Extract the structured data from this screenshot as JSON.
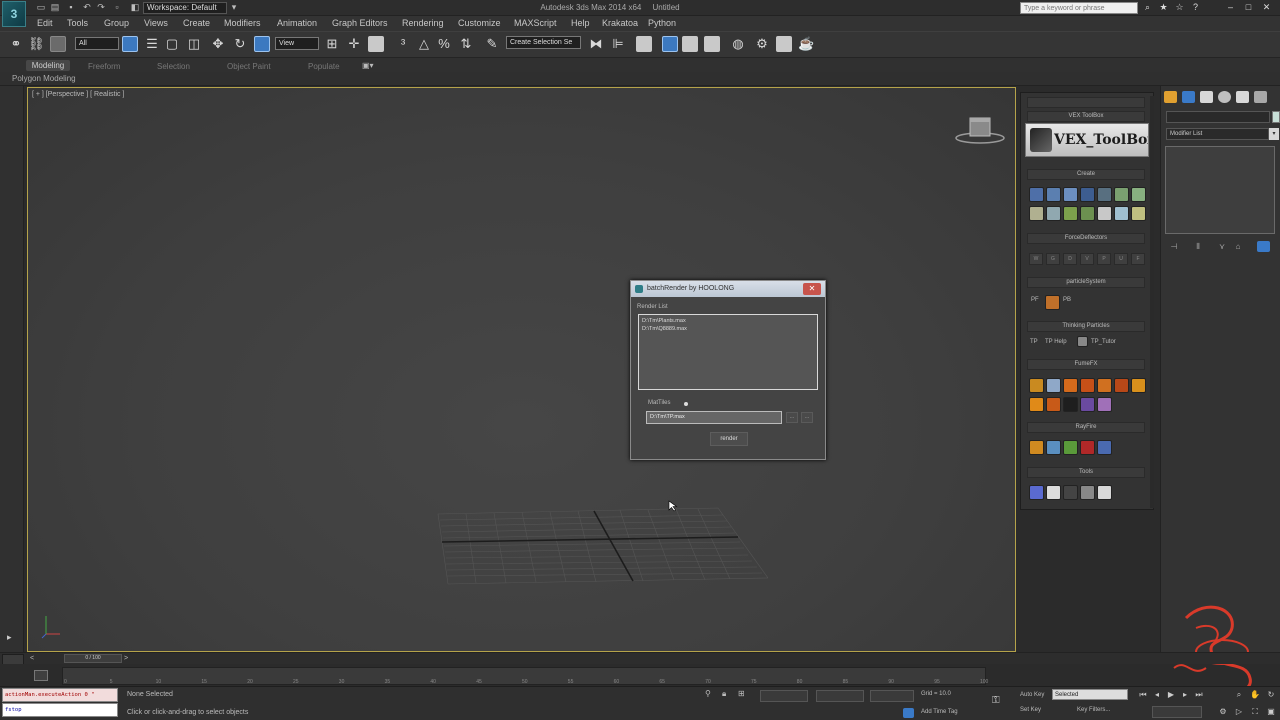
{
  "window": {
    "title": "Autodesk 3ds Max  2014 x64",
    "title_suffix": "Untitled",
    "workspace": "Workspace: Default",
    "search_placeholder": "Type a keyword or phrase"
  },
  "menubar": {
    "items": [
      "Edit",
      "Tools",
      "Group",
      "Views",
      "Create",
      "Modifiers",
      "Animation",
      "Graph Editors",
      "Rendering",
      "Customize",
      "MAXScript",
      "Help",
      "Krakatoa",
      "Python"
    ]
  },
  "toolbar": {
    "selection_filter": "All",
    "reference_coord": "View",
    "named_selection": "Create Selection Se"
  },
  "ribbon": {
    "tabs": [
      "Modeling",
      "Freeform",
      "Selection",
      "Object Paint",
      "Populate"
    ],
    "sub_label": "Polygon Modeling"
  },
  "viewport": {
    "label": "[ + ] [Perspective ] [ Realistic ]"
  },
  "dialog": {
    "title": "batchRender by HOOLONG",
    "render_list_label": "Render List",
    "render_list": [
      "D:\\Tm\\Plants.max",
      "D:\\Tm\\Q8889.max"
    ],
    "mattiles_label": "MatTiles",
    "path_value": "D:\\Tm\\TP.max",
    "browse_label": "...",
    "add_label": "...",
    "render_button": "render"
  },
  "toolbox": {
    "header": "VEX ToolBox",
    "banner_text": "VEX_ToolBox",
    "sections": [
      {
        "title": "Create"
      },
      {
        "title": "ForceDeflectors"
      },
      {
        "title": "particleSystem"
      },
      {
        "title": "Thinking Particles"
      },
      {
        "title": "FumeFX"
      },
      {
        "title": "RayFire"
      },
      {
        "title": "Tools"
      }
    ],
    "tp_items": [
      "TP",
      "TP Help",
      "TP_Tutor"
    ],
    "ps_items": [
      "PF",
      "PB"
    ]
  },
  "cmdpanel": {
    "modifier_list": "Modifier List"
  },
  "timeline": {
    "slider_label": "0 / 100",
    "ticks": [
      "0",
      "5",
      "10",
      "15",
      "20",
      "25",
      "30",
      "35",
      "40",
      "45",
      "50",
      "55",
      "60",
      "65",
      "70",
      "75",
      "80",
      "85",
      "90",
      "95",
      "100"
    ]
  },
  "status": {
    "listener_output": "actionMan.executeAction 0 \"",
    "listener_input": "fstop",
    "selected": "None Selected",
    "prompt": "Click or click-and-drag to select objects",
    "grid": "Grid = 10.0",
    "add_time_tag": "Add Time Tag",
    "auto_key": "Auto Key",
    "set_key": "Set Key",
    "auto_key_mode": "Selected",
    "key_filters": "Key Filters..."
  },
  "colors": {
    "viewport_border": "#b5a34a",
    "dialog_close": "#c7544c",
    "listener_text": "#a00000"
  }
}
